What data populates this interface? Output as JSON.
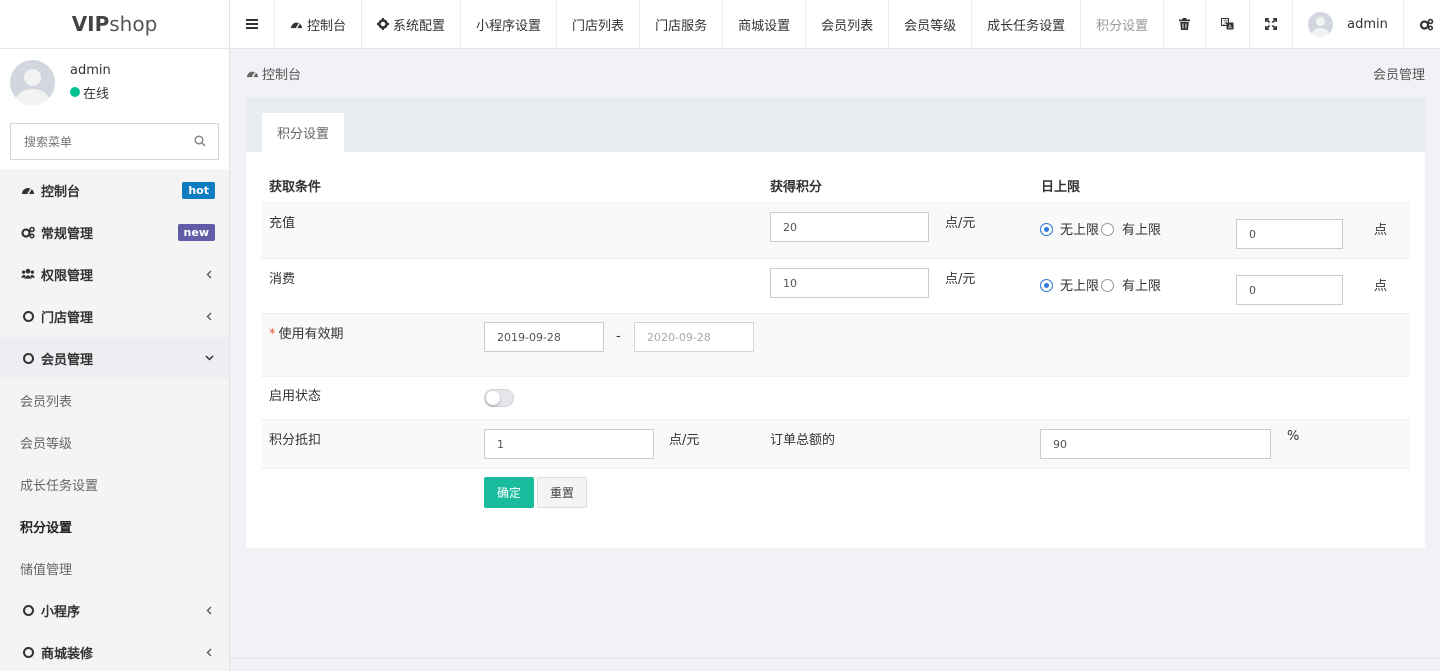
{
  "brand": {
    "bold": "VIP",
    "rest": "shop"
  },
  "user": {
    "name": "admin",
    "status": "在线"
  },
  "sidebar": {
    "search_placeholder": "搜索菜单",
    "items": [
      {
        "label": "控制台",
        "badge": "hot"
      },
      {
        "label": "常规管理",
        "badge": "new"
      },
      {
        "label": "权限管理"
      },
      {
        "label": "门店管理"
      },
      {
        "label": "会员管理"
      },
      {
        "label": "会员列表"
      },
      {
        "label": "会员等级"
      },
      {
        "label": "成长任务设置"
      },
      {
        "label": "积分设置"
      },
      {
        "label": "储值管理"
      },
      {
        "label": "小程序"
      },
      {
        "label": "商城装修"
      }
    ]
  },
  "topnav": {
    "items": [
      "控制台",
      "系统配置",
      "小程序设置",
      "门店列表",
      "门店服务",
      "商城设置",
      "会员列表",
      "会员等级",
      "成长任务设置",
      "积分设置"
    ],
    "admin": "admin"
  },
  "breadcrumb": {
    "current": "控制台",
    "right": "会员管理"
  },
  "tab": {
    "label": "积分设置"
  },
  "form": {
    "headers": {
      "condition": "获取条件",
      "points": "获得积分",
      "limit": "日上限"
    },
    "rows": [
      {
        "label": "充值",
        "points": "20",
        "unit": "点/元",
        "no_limit": "无上限",
        "has_limit": "有上限",
        "limit_value": "0",
        "limit_unit": "点"
      },
      {
        "label": "消费",
        "points": "10",
        "unit": "点/元",
        "no_limit": "无上限",
        "has_limit": "有上限",
        "limit_value": "0",
        "limit_unit": "点"
      }
    ],
    "validity": {
      "required": "*",
      "label": "使用有效期",
      "start": "2019-09-28",
      "sep": "-",
      "end_placeholder": "2020-09-28"
    },
    "status": {
      "label": "启用状态",
      "enabled": false
    },
    "deduct": {
      "label": "积分抵扣",
      "value": "1",
      "unit": "点/元",
      "order_label": "订单总额的",
      "percent": "90",
      "percent_unit": "%"
    },
    "buttons": {
      "ok": "确定",
      "reset": "重置"
    }
  },
  "colors": {
    "primary": "#18bc9c",
    "hot": "#0f7cc1",
    "new": "#605ca8",
    "online": "#00c292",
    "radio": "#2f7bd8"
  }
}
